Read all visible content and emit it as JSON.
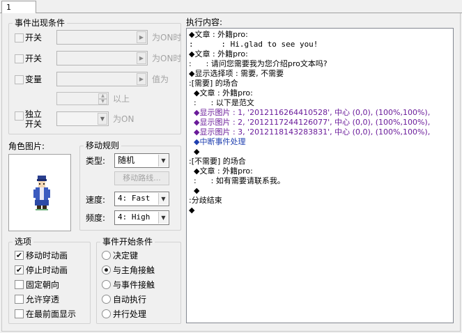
{
  "tab": {
    "label": "1"
  },
  "conditions": {
    "title": "事件出现条件",
    "switch1": {
      "label": "开关",
      "suffix": "为ON时"
    },
    "switch2": {
      "label": "开关",
      "suffix": "为ON时"
    },
    "variable": {
      "label": "变量",
      "suffix": "值为",
      "above": "以上"
    },
    "self_switch": {
      "label_line1": "独立",
      "label_line2": "开关",
      "suffix": "为ON"
    }
  },
  "graphic": {
    "title": "角色图片:"
  },
  "movement": {
    "title": "移动规则",
    "type_label": "类型:",
    "type_value": "随机",
    "route_button": "移动路线...",
    "speed_label": "速度:",
    "speed_value": "4: Fast",
    "freq_label": "频度:",
    "freq_value": "4: High"
  },
  "options": {
    "title": "选项",
    "items": [
      {
        "label": "移动时动画",
        "checked": true
      },
      {
        "label": "停止时动画",
        "checked": true
      },
      {
        "label": "固定朝向",
        "checked": false
      },
      {
        "label": "允许穿透",
        "checked": false
      },
      {
        "label": "在最前面显示",
        "checked": false
      }
    ]
  },
  "trigger": {
    "title": "事件开始条件",
    "items": [
      {
        "label": "决定键",
        "selected": false
      },
      {
        "label": "与主角接触",
        "selected": true
      },
      {
        "label": "与事件接触",
        "selected": false
      },
      {
        "label": "自动执行",
        "selected": false
      },
      {
        "label": "并行处理",
        "selected": false
      }
    ]
  },
  "execution": {
    "title": "执行内容:",
    "lines": [
      "◆文章 : 外籍pro:",
      ":      : Hi.glad to see you!",
      "◆文章 : 外籍pro:",
      ":      : 请问您需要我为您介绍pro文本吗?",
      "◆显示选择项 : 需要, 不需要",
      ":[需要] 的场合",
      "  ◆文章 : 外籍pro:",
      "  :      : 以下是范文",
      "  ◆显示图片 : 1, '2012116264410528', 中心 (0,0), (100%,100%),",
      "  ◆显示图片 : 2, '2012117244126077', 中心 (0,0), (100%,100%),",
      "  ◆显示图片 : 3, '2012118143283831', 中心 (0,0), (100%,100%),",
      "  ◆中断事件处理",
      "  ◆",
      ":[不需要] 的场合",
      "  ◆文章 : 外籍pro:",
      "  :      : 如有需要请联系我。",
      "  ◆",
      ":分歧结束",
      "◆"
    ]
  },
  "colors": {
    "picture_cmd": "#6a1b9a",
    "break_cmd": "#1f3fb0"
  }
}
